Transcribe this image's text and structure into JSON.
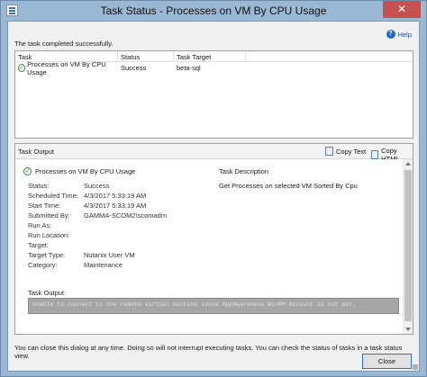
{
  "window": {
    "title": "Task Status - Processes on VM By CPU Usage",
    "close_glyph": "✕"
  },
  "help": {
    "label": "Help",
    "glyph": "?"
  },
  "completed_message": "The task completed successfully.",
  "task_grid": {
    "columns": [
      "Task",
      "Status",
      "Task Target"
    ],
    "rows": [
      {
        "task": "Processes on VM By CPU Usage",
        "status": "Success",
        "target": "beta-sql"
      }
    ]
  },
  "output": {
    "title": "Task Output",
    "copy_text": "Copy Text",
    "copy_html": "Copy HTML",
    "task_name": "Processes on VM By CPU Usage",
    "description_heading": "Task Description",
    "description": "Get Processes on selected VM Sorted By Cpu",
    "fields": [
      {
        "key": "Status:",
        "value": "Success"
      },
      {
        "key": "Scheduled Time:",
        "value": "4/3/2017 5:33:19 AM"
      },
      {
        "key": "Start Time:",
        "value": "4/3/2017 5:33:19 AM"
      },
      {
        "key": "Submitted By:",
        "value": "GAMMA-SCOM2\\scomadm"
      },
      {
        "key": "Run As:",
        "value": ""
      },
      {
        "key": "Run Location:",
        "value": ""
      },
      {
        "key": "Target:",
        "value": ""
      },
      {
        "key": "Target Type:",
        "value": "Nutanix User VM"
      },
      {
        "key": "Category:",
        "value": "Maintenance"
      }
    ],
    "output_label": "Task Output:",
    "output_text": "Unable to connect to the remote virtual machine since AppAwareness WinRM Account is not set."
  },
  "footer": "You can close this dialog at any time. Doing so will not interrupt executing tasks. You can check the status of tasks in a task status view.",
  "close_button": "Close",
  "colors": {
    "title_bar": "#9ab8d3",
    "close": "#c75050",
    "accent": "#2c70c6"
  }
}
